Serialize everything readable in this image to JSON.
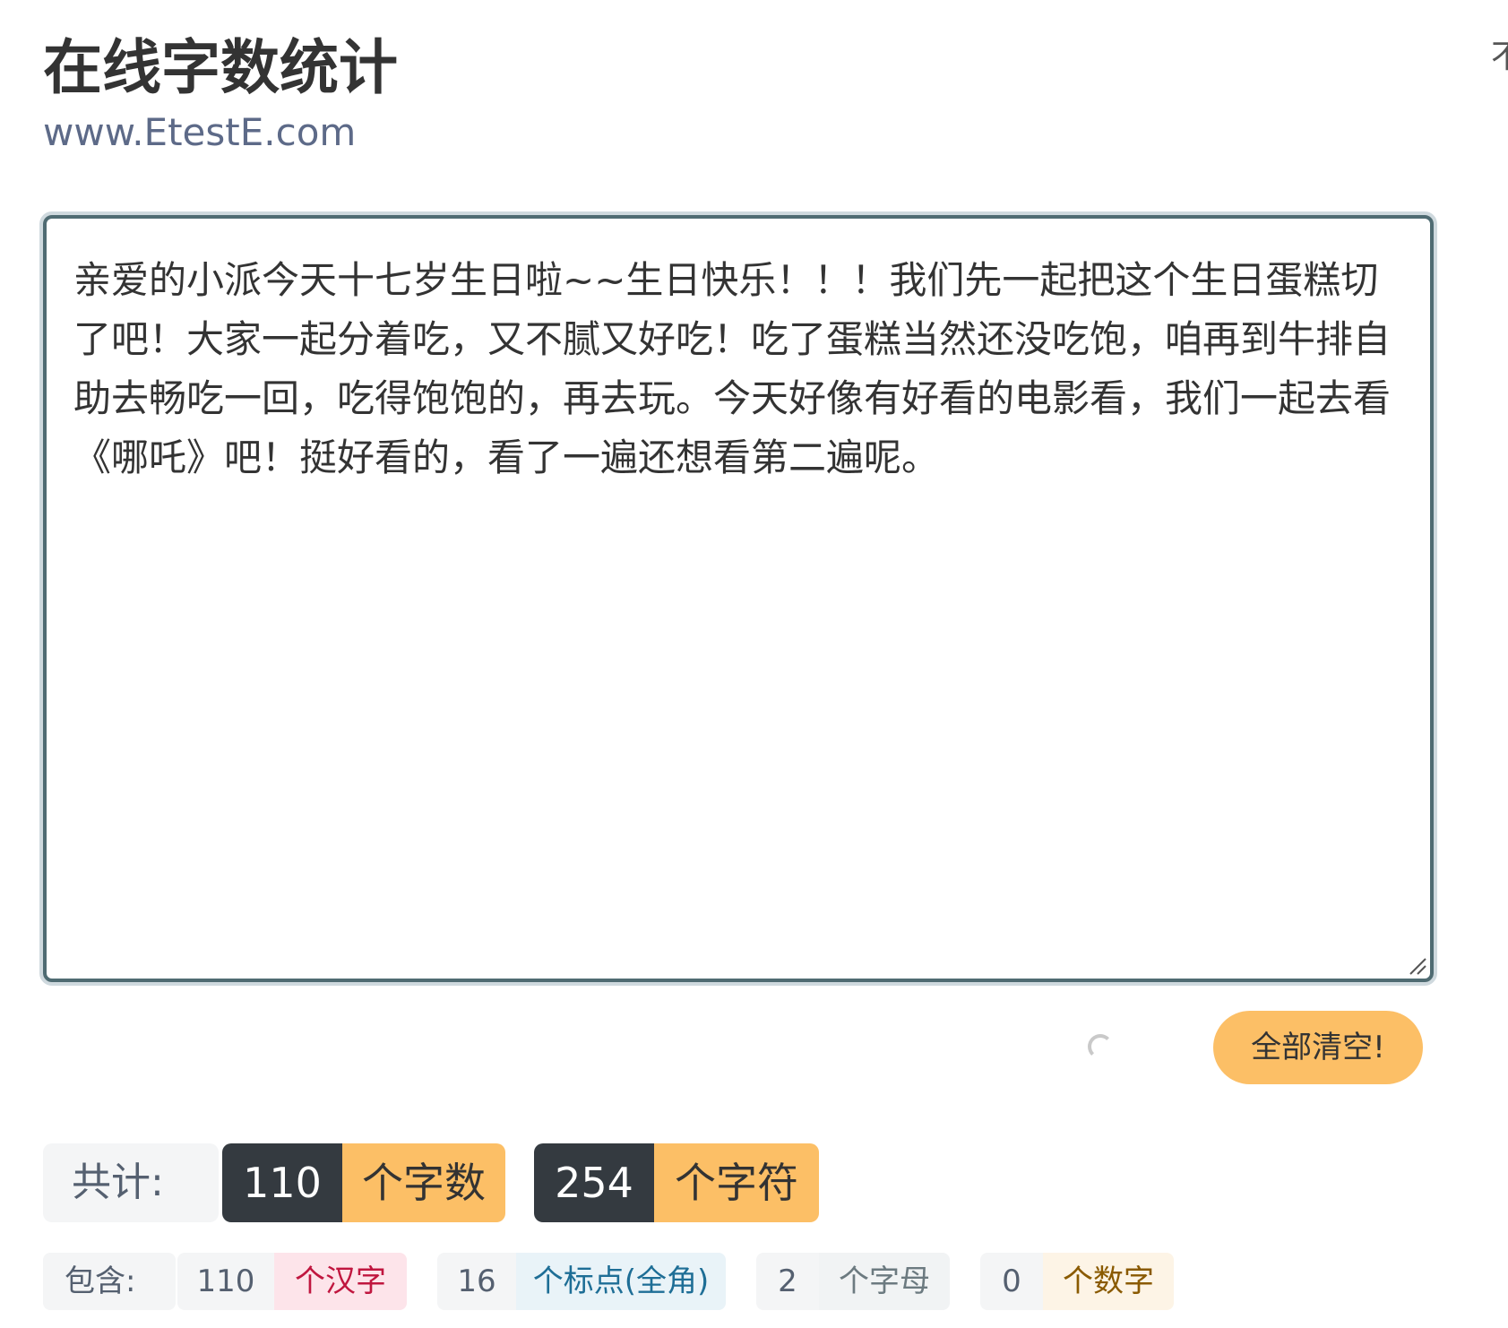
{
  "header": {
    "title": "在线字数统计",
    "site_url": "www.EtestE.com",
    "edge_glyph": "不"
  },
  "editor": {
    "value": "亲爱的小派今天十七岁生日啦~~生日快乐！！！我们先一起把这个生日蛋糕切了吧！大家一起分着吃，又不腻又好吃！吃了蛋糕当然还没吃饱，咱再到牛排自助去畅吃一回，吃得饱饱的，再去玩。今天好像有好看的电影看，我们一起去看《哪吒》吧！挺好看的，看了一遍还想看第二遍呢。"
  },
  "actions": {
    "clear_label": "全部清空!"
  },
  "icons": {
    "loading": "loading-spinner-icon",
    "resize": "resize-handle-icon"
  },
  "totals": {
    "label": "共计:",
    "word_count": "110",
    "word_unit": "个字数",
    "char_count": "254",
    "char_unit": "个字符"
  },
  "breakdown": {
    "label": "包含:",
    "items": [
      {
        "count": "110",
        "unit": "个汉字",
        "color": "#c0163f",
        "bg": "#fde4ea"
      },
      {
        "count": "16",
        "unit": "个标点(全角)",
        "color": "#1e6e96",
        "bg": "#e9f3f8"
      },
      {
        "count": "2",
        "unit": "个字母",
        "color": "#6c7a80",
        "bg": "#f1f3f4"
      },
      {
        "count": "0",
        "unit": "个数字",
        "color": "#8a5a00",
        "bg": "#fdf4e6"
      }
    ]
  },
  "colors": {
    "accent": "#fcbf66",
    "dark_badge": "#343a40",
    "editor_border": "#4f6b72",
    "url": "#5d6a88"
  }
}
